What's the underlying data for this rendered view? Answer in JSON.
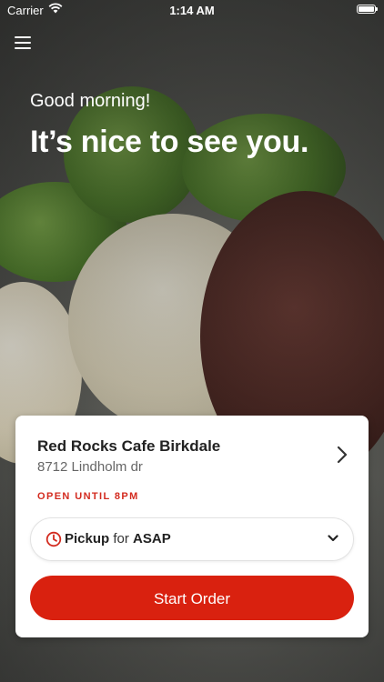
{
  "status_bar": {
    "carrier": "Carrier",
    "time": "1:14 AM"
  },
  "hero": {
    "greeting": "Good morning!",
    "headline": "It’s nice to see you."
  },
  "store": {
    "name": "Red Rocks Cafe Birkdale",
    "address": "8712 Lindholm dr",
    "hours": "OPEN UNTIL 8PM"
  },
  "order_mode": {
    "mode": "Pickup",
    "connector": "for",
    "time": "ASAP"
  },
  "actions": {
    "start_order": "Start Order"
  },
  "colors": {
    "accent": "#d9210f",
    "hours_text": "#d32b1f"
  },
  "icons": [
    "menu-icon",
    "wifi-icon",
    "battery-icon",
    "chevron-right-icon",
    "clock-icon",
    "chevron-down-icon"
  ]
}
